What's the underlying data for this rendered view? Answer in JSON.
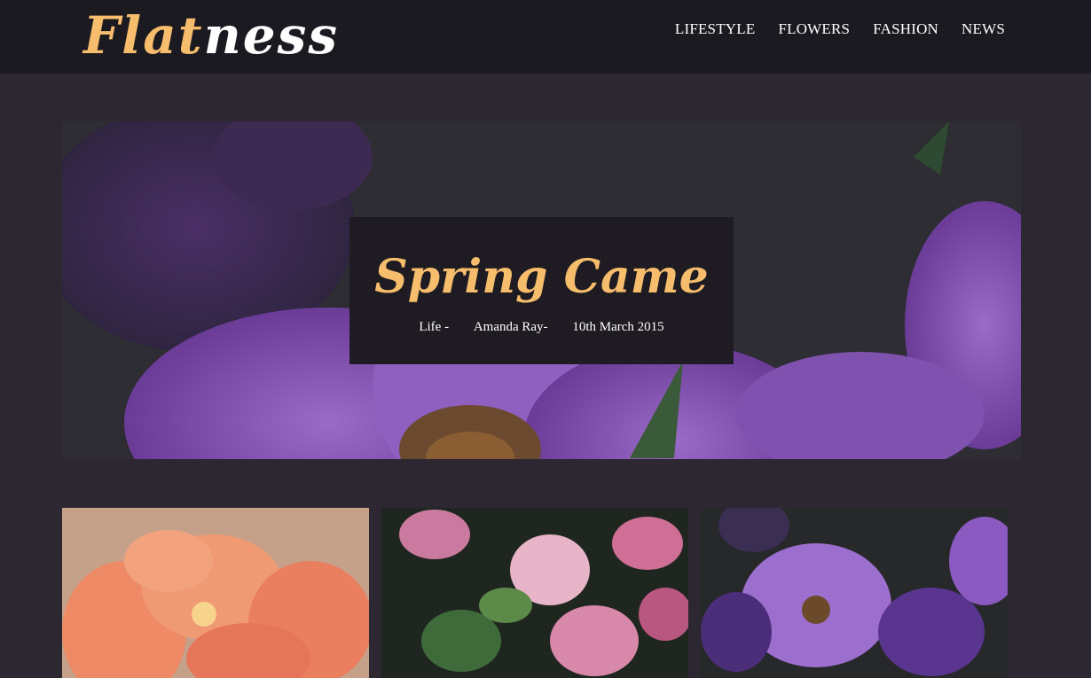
{
  "header": {
    "logo_part1": "Flat",
    "logo_part2": "ness",
    "nav": [
      "LIFESTYLE",
      "FLOWERS",
      "FASHION",
      "NEWS"
    ]
  },
  "hero": {
    "title": "Spring Came",
    "category": "Life -",
    "author": "Amanda Ray-",
    "date": "10th March 2015"
  },
  "cards": [
    {
      "image": "orange-lily-photo"
    },
    {
      "image": "pink-blossom-photo"
    },
    {
      "image": "purple-petunia-photo"
    }
  ],
  "colors": {
    "accent": "#f6bd6c",
    "header_bg": "#1c1a21",
    "page_bg": "#2d2732",
    "overlay_bg": "#1e1b22"
  }
}
